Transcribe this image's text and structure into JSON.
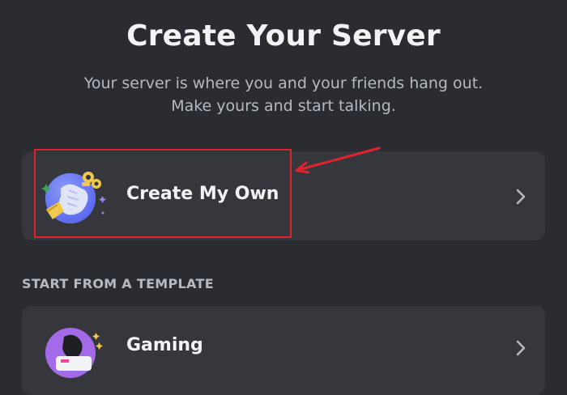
{
  "header": {
    "title": "Create Your Server",
    "subtitle_line1": "Your server is where you and your friends hang out.",
    "subtitle_line2": "Make yours and start talking."
  },
  "create_card": {
    "label": "Create My Own",
    "icon": "server-illustration-icon",
    "chevron_icon": "chevron-right-icon"
  },
  "template_section": {
    "header": "START FROM A TEMPLATE",
    "items": [
      {
        "label": "Gaming",
        "icon": "gaming-illustration-icon",
        "chevron_icon": "chevron-right-icon"
      }
    ]
  },
  "annotation": {
    "highlight_color": "#e0232e"
  },
  "colors": {
    "background": "#2b2c31",
    "card": "#36373d",
    "text_primary": "#f2f3f5",
    "text_secondary": "#b5bac1"
  }
}
